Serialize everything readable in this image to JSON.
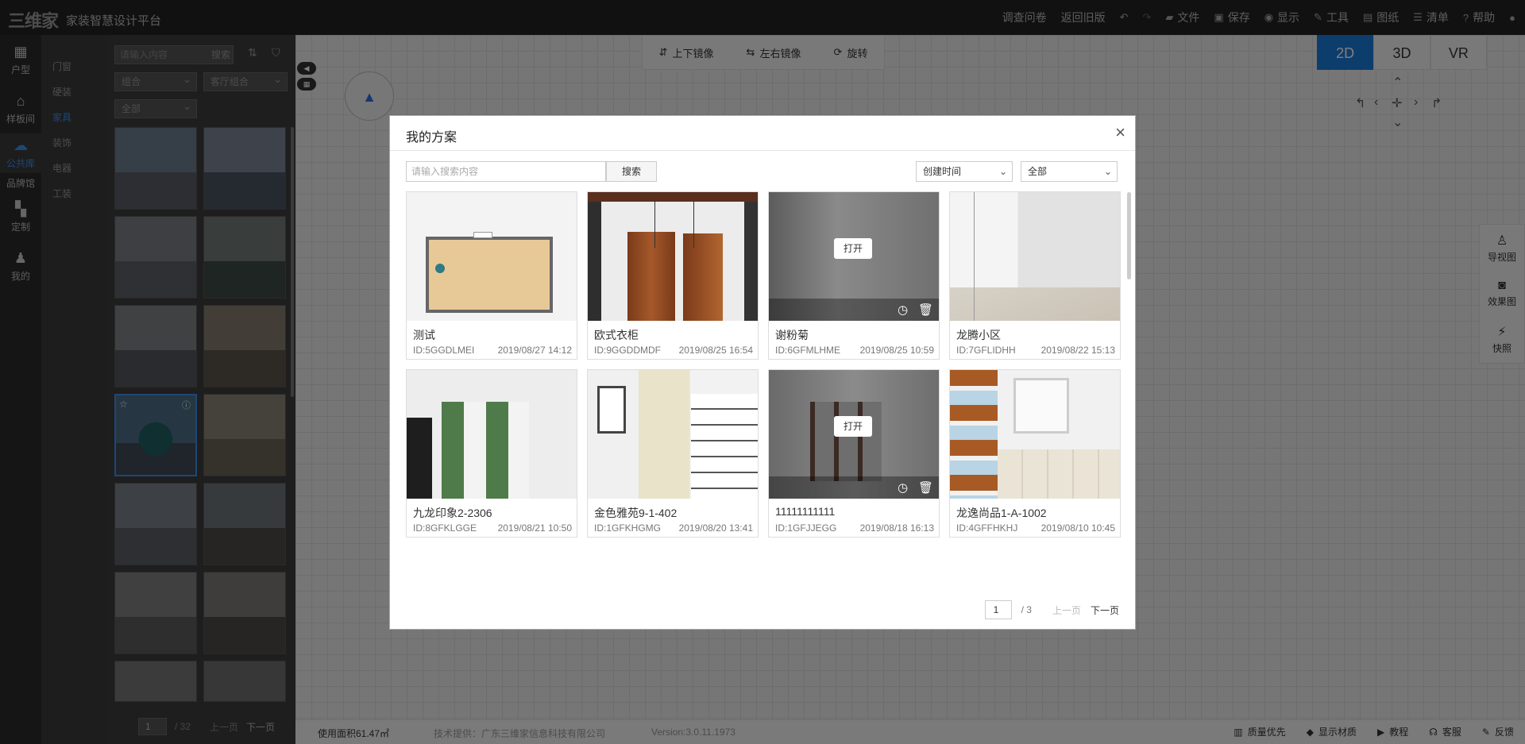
{
  "app": {
    "logo": "三维家",
    "title": "家装智慧设计平台"
  },
  "topmenu": [
    {
      "label": "调查问卷",
      "icon": ""
    },
    {
      "label": "返回旧版",
      "icon": ""
    },
    {
      "label": "",
      "icon": "undo-icon"
    },
    {
      "label": "",
      "icon": "redo-icon"
    },
    {
      "label": "文件",
      "icon": "folder-icon"
    },
    {
      "label": "保存",
      "icon": "save-icon"
    },
    {
      "label": "显示",
      "icon": "eye-icon"
    },
    {
      "label": "工具",
      "icon": "wrench-icon"
    },
    {
      "label": "图纸",
      "icon": "map-icon"
    },
    {
      "label": "清单",
      "icon": "list-icon"
    },
    {
      "label": "帮助",
      "icon": "help-icon"
    },
    {
      "label": "",
      "icon": "user-icon"
    }
  ],
  "leftnav": [
    {
      "label": "户型",
      "icon": "floorplan-icon"
    },
    {
      "label": "样板间",
      "icon": "house-icon"
    },
    {
      "label": "公共库",
      "icon": "cloud-icon",
      "active": true
    },
    {
      "label": "品牌馆",
      "icon": ""
    },
    {
      "label": "定制",
      "icon": "custom-icon"
    },
    {
      "label": "我的",
      "icon": "person-icon"
    }
  ],
  "categories": [
    "门窗",
    "硬装",
    "家具",
    "装饰",
    "电器",
    "工装"
  ],
  "active_category": "家具",
  "modelpanel": {
    "search_placeholder": "请输入内容",
    "search_label": "搜索",
    "select1": "组合",
    "select2": "客厅组合",
    "select3": "全部",
    "pager": {
      "current": "1",
      "total": "/ 32",
      "prev": "上一页",
      "next": "下一页"
    }
  },
  "toolbar": [
    {
      "label": "上下镜像",
      "icon": "flip-vertical-icon"
    },
    {
      "label": "左右镜像",
      "icon": "flip-horizontal-icon"
    },
    {
      "label": "旋转",
      "icon": "rotate-icon"
    }
  ],
  "views": [
    "2D",
    "3D",
    "VR"
  ],
  "rightdock": [
    {
      "label": "导视图",
      "icon": "navigator-icon"
    },
    {
      "label": "效果图",
      "icon": "camera-icon"
    },
    {
      "label": "快照",
      "icon": "snapshot-icon"
    }
  ],
  "statusbar": {
    "area": "使用面积61.47㎡",
    "provider": "技术提供：广东三维家信息科技有限公司",
    "version": "Version:3.0.11.1973",
    "right": [
      {
        "label": "质量优先",
        "icon": "quality-icon"
      },
      {
        "label": "显示材质",
        "icon": "cube-icon"
      },
      {
        "label": "教程",
        "icon": "play-icon"
      },
      {
        "label": "客服",
        "icon": "headset-icon"
      },
      {
        "label": "反馈",
        "icon": "feedback-icon"
      }
    ]
  },
  "modal": {
    "title": "我的方案",
    "close": "×",
    "search_placeholder": "请输入搜索内容",
    "search_label": "搜索",
    "sort_select": "创建时间",
    "filter_select": "全部",
    "open_label": "打开",
    "cards": [
      {
        "name": "测试",
        "id": "ID:5GGDLMEI",
        "date": "2019/08/27 14:12"
      },
      {
        "name": "欧式衣柜",
        "id": "ID:9GGDDMDF",
        "date": "2019/08/25 16:54"
      },
      {
        "name": "谢粉菊",
        "id": "ID:6GFMLHME",
        "date": "2019/08/25 10:59"
      },
      {
        "name": "龙腾小区",
        "id": "ID:7GFLIDHH",
        "date": "2019/08/22 15:13"
      },
      {
        "name": "九龙印象2-2306",
        "id": "ID:8GFKLGGE",
        "date": "2019/08/21 10:50"
      },
      {
        "name": "金色雅苑9-1-402",
        "id": "ID:1GFKHGMG",
        "date": "2019/08/20 13:41"
      },
      {
        "name": "11111111111",
        "id": "ID:1GFJJEGG",
        "date": "2019/08/18 16:13"
      },
      {
        "name": "龙逸尚品1-A-1002",
        "id": "ID:4GFFHKHJ",
        "date": "2019/08/10 10:45"
      }
    ],
    "pager": {
      "current": "1",
      "total": "/ 3",
      "prev": "上一页",
      "next": "下一页"
    }
  }
}
